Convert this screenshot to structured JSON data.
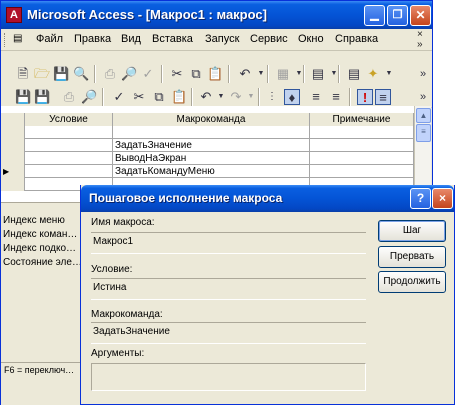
{
  "window": {
    "title": "Microsoft Access - [Макрос1 : макрос]",
    "icon_letter": "A"
  },
  "menu": {
    "items": [
      "Файл",
      "Правка",
      "Вид",
      "Вставка",
      "Запуск",
      "Сервис",
      "Окно",
      "Справка"
    ],
    "mdi_close": "×",
    "overflow": "»"
  },
  "toolbar1": {
    "icons": [
      "new-icon",
      "open-icon",
      "save-icon",
      "search-icon",
      "print-icon",
      "preview-icon",
      "spelling-icon",
      "cut-icon",
      "copy-icon",
      "paste-icon",
      "undo-icon",
      "office-links-icon",
      "analyze-icon",
      "relationships-icon",
      "new-object-icon"
    ]
  },
  "toolbar2": {
    "icons": [
      "save-icon",
      "properties-icon",
      "print-icon",
      "preview-icon",
      "cut-icon",
      "copy-icon",
      "paste-icon",
      "undo-icon",
      "redo-icon",
      "macro-names-icon",
      "conditions-icon",
      "insert-rows-icon",
      "run-icon",
      "step-icon"
    ]
  },
  "grid": {
    "headers": [
      "Условие",
      "Макрокоманда",
      "Примечание"
    ],
    "rows": [
      {
        "condition": "",
        "action": "",
        "note": ""
      },
      {
        "condition": "",
        "action": "ЗадатьЗначение",
        "note": ""
      },
      {
        "condition": "",
        "action": "ВыводНаЭкран",
        "note": ""
      },
      {
        "condition": "",
        "action": "ЗадатьКомандуМеню",
        "note": "",
        "current": true
      },
      {
        "condition": "",
        "action": "",
        "note": ""
      }
    ]
  },
  "arguments": {
    "labels": [
      "Индекс меню",
      "Индекс коман…",
      "Индекс подко…",
      "Состояние эле…"
    ]
  },
  "status": {
    "text": "F6 = переключ…"
  },
  "dialog": {
    "title": "Пошаговое исполнение макроса",
    "help": "?",
    "close": "×",
    "macro_name_label": "Имя макроса:",
    "macro_name_value": "Макрос1",
    "condition_label": "Условие:",
    "condition_value": "Истина",
    "action_label": "Макрокоманда:",
    "action_value": "ЗадатьЗначение",
    "arguments_label": "Аргументы:",
    "arguments_value": "",
    "buttons": {
      "step": "Шаг",
      "stop": "Прервать",
      "continue": "Продолжить"
    }
  }
}
